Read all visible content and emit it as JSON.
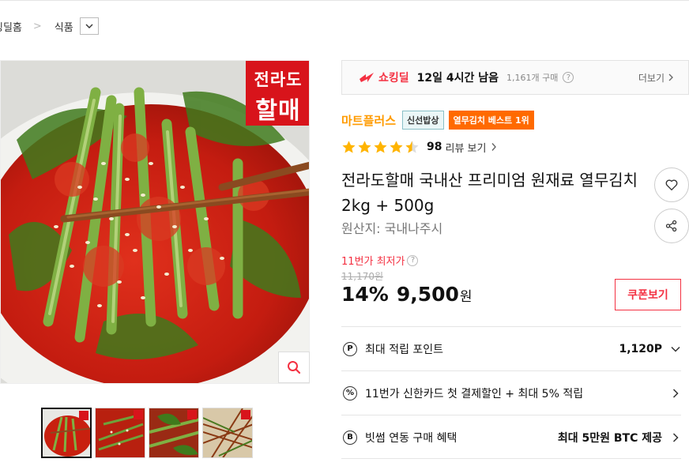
{
  "breadcrumb": {
    "home": "킹딜홈",
    "category": "식품"
  },
  "image": {
    "logo_line1": "전라도",
    "logo_line2": "할매"
  },
  "deal": {
    "name": "쇼킹딜",
    "remaining": "12일 4시간 남음",
    "purchase_count": "1,161개 구매",
    "more_label": "더보기"
  },
  "seller": {
    "name": "마트플러스",
    "badge_fresh": "신선밥상",
    "badge_best": "열무김치 베스트 1위"
  },
  "rating": {
    "stars": 4.5,
    "review_count": "98",
    "review_label": "리뷰 보기"
  },
  "product": {
    "title": "전라도할매 국내산 프리미엄 원재료 열무김치 2kg + 500g",
    "origin": "원산지:  국내나주시"
  },
  "price": {
    "lowest_label": "11번가 최저가",
    "original": "11,170원",
    "discount": "14%",
    "sale": "9,500",
    "currency": "원",
    "coupon_label": "쿠폰보기"
  },
  "benefits": [
    {
      "icon": "P",
      "label": "최대 적립 포인트",
      "value": "1,120P"
    },
    {
      "icon": "%",
      "label": "11번가 신한카드 첫 결제할인 + 최대 5% 적립",
      "value": ""
    },
    {
      "icon": "B",
      "label": "빗썸 연동 구매 혜택",
      "value": "최대 5만원 BTC 제공"
    }
  ],
  "colors": {
    "accent_red": "#f43142",
    "seller_orange": "#ff9b00",
    "best_badge": "#ff6a00",
    "star": "#ffb400"
  }
}
